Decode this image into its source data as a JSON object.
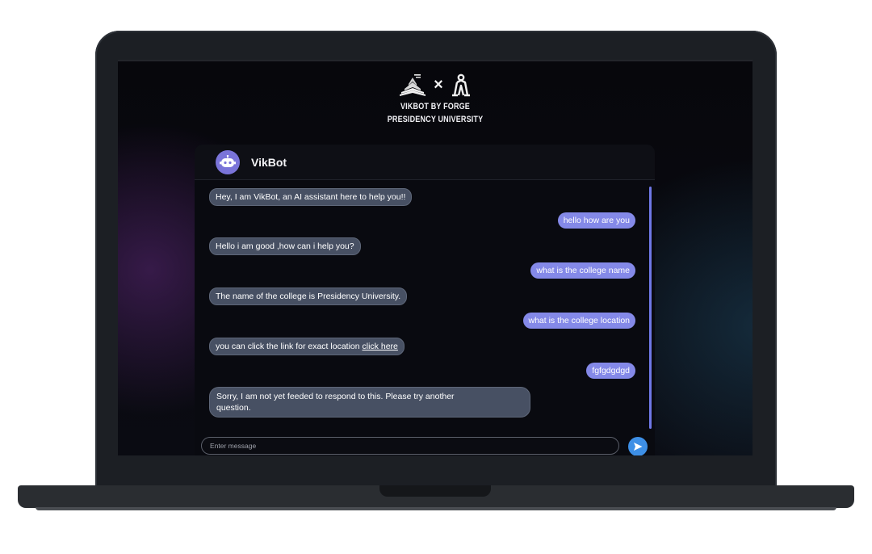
{
  "branding": {
    "line1": "VIKBOT BY FORGE",
    "line2": "PRESIDENCY UNIVERSITY",
    "separator": "×",
    "left_logo_icon": "open-book-logo-icon",
    "right_logo_icon": "forge-figure-logo-icon"
  },
  "chat": {
    "bot_name": "VikBot",
    "avatar_icon": "robot-icon",
    "messages": [
      {
        "sender": "bot",
        "text": "Hey, I am VikBot, an AI assistant here to help you!!"
      },
      {
        "sender": "user",
        "text": "hello how are you"
      },
      {
        "sender": "bot",
        "text": "Hello i am good ,how can i help you?"
      },
      {
        "sender": "user",
        "text": "what is the college name"
      },
      {
        "sender": "bot",
        "text": "The name of the college is Presidency University."
      },
      {
        "sender": "user",
        "text": "what is the college location"
      },
      {
        "sender": "bot",
        "text": "you can click the link for exact location",
        "link": "click here"
      },
      {
        "sender": "user",
        "text": "fgfgdgdgd"
      },
      {
        "sender": "bot",
        "text_line1": "Sorry, I am not yet feeded to respond to this. Please try another",
        "text_line2": "question."
      }
    ],
    "input_placeholder": "Enter message",
    "send_icon": "send-arrow-icon"
  },
  "colors": {
    "user_bubble": "#8489e8",
    "bot_bubble": "#475063",
    "send_button": "#3d8fe6",
    "avatar": "#7a74d9"
  }
}
